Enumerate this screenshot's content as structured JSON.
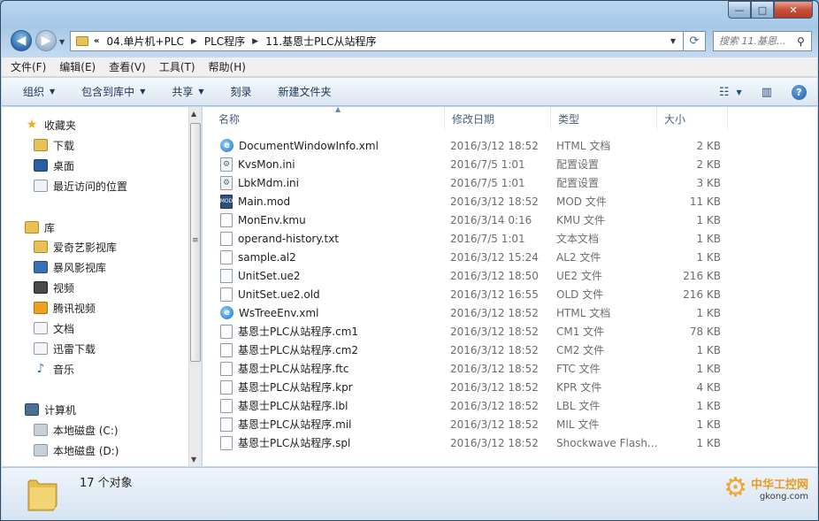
{
  "window": {
    "caption": {
      "minimize": "—",
      "maximize": "□",
      "close": "✕"
    }
  },
  "address": {
    "overflow": "«",
    "crumbs": [
      "04.单片机+PLC",
      "PLC程序",
      "11.基恩士PLC从站程序"
    ],
    "search_placeholder": "搜索 11.基恩..."
  },
  "menu": [
    "文件(F)",
    "编辑(E)",
    "查看(V)",
    "工具(T)",
    "帮助(H)"
  ],
  "toolbar": {
    "organize": "组织",
    "include_library": "包含到库中",
    "share": "共享",
    "burn": "刻录",
    "new_folder": "新建文件夹"
  },
  "navpane": {
    "favorites": {
      "label": "收藏夹",
      "items": [
        "下载",
        "桌面",
        "最近访问的位置"
      ]
    },
    "libraries": {
      "label": "库",
      "items": [
        "爱奇艺影视库",
        "暴风影视库",
        "视频",
        "腾讯视频",
        "文档",
        "迅雷下载",
        "音乐"
      ]
    },
    "computer": {
      "label": "计算机",
      "items": [
        "本地磁盘 (C:)",
        "本地磁盘 (D:)"
      ]
    }
  },
  "columns": {
    "name": "名称",
    "date": "修改日期",
    "type": "类型",
    "size": "大小"
  },
  "files": [
    {
      "name": "DocumentWindowInfo.xml",
      "date": "2016/3/12 18:52",
      "type": "HTML 文档",
      "size": "2 KB",
      "icon": "ie"
    },
    {
      "name": "KvsMon.ini",
      "date": "2016/7/5 1:01",
      "type": "配置设置",
      "size": "2 KB",
      "icon": "ini"
    },
    {
      "name": "LbkMdm.ini",
      "date": "2016/7/5 1:01",
      "type": "配置设置",
      "size": "3 KB",
      "icon": "ini"
    },
    {
      "name": "Main.mod",
      "date": "2016/3/12 18:52",
      "type": "MOD 文件",
      "size": "11 KB",
      "icon": "mod"
    },
    {
      "name": "MonEnv.kmu",
      "date": "2016/3/14 0:16",
      "type": "KMU 文件",
      "size": "1 KB",
      "icon": "file"
    },
    {
      "name": "operand-history.txt",
      "date": "2016/7/5 1:01",
      "type": "文本文档",
      "size": "1 KB",
      "icon": "file"
    },
    {
      "name": "sample.al2",
      "date": "2016/3/12 15:24",
      "type": "AL2 文件",
      "size": "1 KB",
      "icon": "file"
    },
    {
      "name": "UnitSet.ue2",
      "date": "2016/3/12 18:50",
      "type": "UE2 文件",
      "size": "216 KB",
      "icon": "file"
    },
    {
      "name": "UnitSet.ue2.old",
      "date": "2016/3/12 16:55",
      "type": "OLD 文件",
      "size": "216 KB",
      "icon": "file"
    },
    {
      "name": "WsTreeEnv.xml",
      "date": "2016/3/12 18:52",
      "type": "HTML 文档",
      "size": "1 KB",
      "icon": "ie"
    },
    {
      "name": "基恩士PLC从站程序.cm1",
      "date": "2016/3/12 18:52",
      "type": "CM1 文件",
      "size": "78 KB",
      "icon": "file"
    },
    {
      "name": "基恩士PLC从站程序.cm2",
      "date": "2016/3/12 18:52",
      "type": "CM2 文件",
      "size": "1 KB",
      "icon": "file"
    },
    {
      "name": "基恩士PLC从站程序.ftc",
      "date": "2016/3/12 18:52",
      "type": "FTC 文件",
      "size": "1 KB",
      "icon": "file"
    },
    {
      "name": "基恩士PLC从站程序.kpr",
      "date": "2016/3/12 18:52",
      "type": "KPR 文件",
      "size": "4 KB",
      "icon": "file"
    },
    {
      "name": "基恩士PLC从站程序.lbl",
      "date": "2016/3/12 18:52",
      "type": "LBL 文件",
      "size": "1 KB",
      "icon": "file"
    },
    {
      "name": "基恩士PLC从站程序.mil",
      "date": "2016/3/12 18:52",
      "type": "MIL 文件",
      "size": "1 KB",
      "icon": "file"
    },
    {
      "name": "基恩士PLC从站程序.spl",
      "date": "2016/3/12 18:52",
      "type": "Shockwave Flash...",
      "size": "1 KB",
      "icon": "file"
    }
  ],
  "status": {
    "count": "17 个对象"
  },
  "watermark": {
    "cn": "中华工控网",
    "en": "gkong.com"
  }
}
